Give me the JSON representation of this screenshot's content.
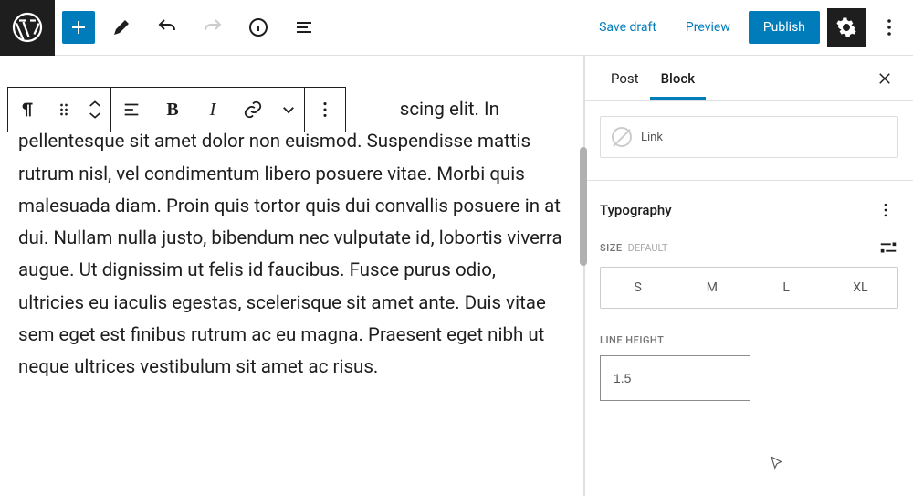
{
  "topbar": {
    "save_draft": "Save draft",
    "preview": "Preview",
    "publish": "Publish"
  },
  "block_toolbar": {
    "bold": "B",
    "italic": "I"
  },
  "content": {
    "line_frag": "scing",
    "rest": "elit. In pellentesque sit amet dolor non euismod. Suspendisse mattis rutrum nisl, vel condimentum libero posuere vitae. Morbi quis malesuada diam. Proin quis tortor quis dui convallis posuere in at dui. Nullam nulla justo, bibendum nec vulputate id, lobortis viverra augue. Ut dignissim ut felis id faucibus. Fusce purus odio, ultricies eu iaculis egestas, scelerisque sit amet ante. Duis vitae sem eget est finibus rutrum ac eu magna. Praesent eget nibh ut neque ultrices vestibulum sit amet ac risus."
  },
  "sidebar": {
    "tabs": {
      "post": "Post",
      "block": "Block"
    },
    "link_label": "Link",
    "typography": {
      "title": "Typography",
      "size_label": "Size",
      "size_default": "Default",
      "options": [
        "S",
        "M",
        "L",
        "XL"
      ],
      "line_height_label": "Line Height",
      "line_height_value": "1.5"
    }
  }
}
